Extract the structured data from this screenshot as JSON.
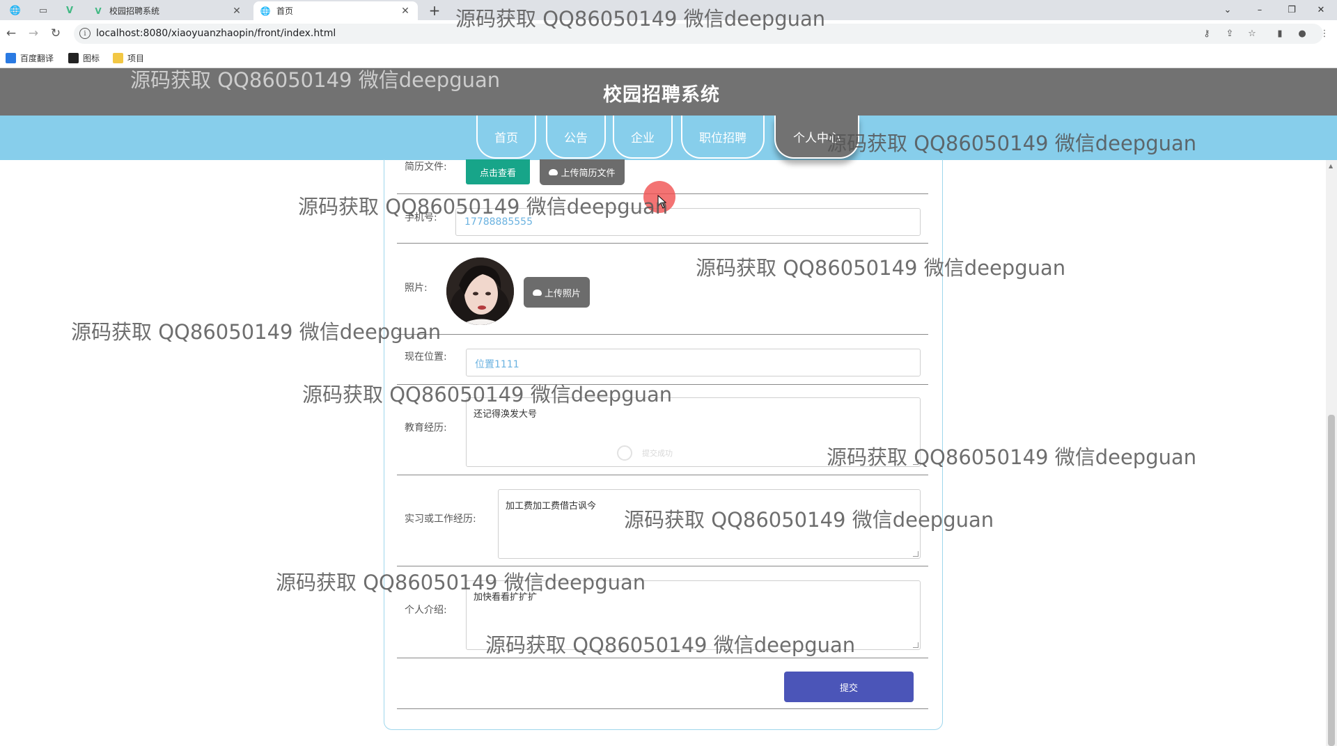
{
  "browser": {
    "tabs": [
      {
        "label": "校园招聘系统",
        "active": false
      },
      {
        "label": "首页",
        "active": true
      }
    ],
    "url": "localhost:8080/xiaoyuanzhaopin/front/index.html",
    "bookmarks": [
      "百度翻译",
      "图标",
      "项目"
    ]
  },
  "site": {
    "title": "校园招聘系统",
    "nav": [
      "首页",
      "公告",
      "企业",
      "职位招聘",
      "个人中心"
    ],
    "nav_active": "个人中心"
  },
  "form": {
    "resume_label": "简历文件:",
    "view_button": "点击查看",
    "upload_resume_button": "上传简历文件",
    "phone_label": "手机号:",
    "phone_value": "17788885555",
    "photo_label": "照片:",
    "upload_photo_button": "上传照片",
    "location_label": "现在位置:",
    "location_value": "位置1111",
    "education_label": "教育经历:",
    "education_value": "还记得涣发大号",
    "experience_label": "实习或工作经历:",
    "experience_value": "加工费加工费借古讽今",
    "intro_label": "个人介绍:",
    "intro_value": "加快看看扩扩扩",
    "submit_button": "提交"
  },
  "toast": {
    "text": "提交成功"
  },
  "watermark": "源码获取 QQ86050149 微信deepguan",
  "colors": {
    "header": "#727272",
    "nav": "#87ceeb",
    "view_button": "#17a589",
    "upload_button": "#6c6c6c",
    "submit_button": "#4b55b8"
  }
}
